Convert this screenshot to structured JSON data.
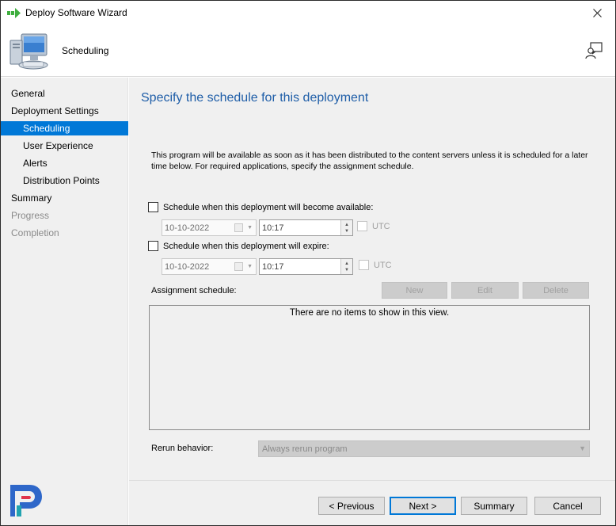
{
  "window": {
    "title": "Deploy Software Wizard"
  },
  "header": {
    "title": "Scheduling"
  },
  "nav": {
    "items": [
      {
        "label": "General",
        "level": 1,
        "state": "normal"
      },
      {
        "label": "Deployment Settings",
        "level": 1,
        "state": "normal"
      },
      {
        "label": "Scheduling",
        "level": 2,
        "state": "selected"
      },
      {
        "label": "User Experience",
        "level": 2,
        "state": "normal"
      },
      {
        "label": "Alerts",
        "level": 2,
        "state": "normal"
      },
      {
        "label": "Distribution Points",
        "level": 2,
        "state": "normal"
      },
      {
        "label": "Summary",
        "level": 1,
        "state": "normal"
      },
      {
        "label": "Progress",
        "level": 1,
        "state": "disabled"
      },
      {
        "label": "Completion",
        "level": 1,
        "state": "disabled"
      }
    ]
  },
  "content": {
    "title": "Specify the schedule for this deployment",
    "description": "This program will be available as soon as it has been distributed to the content servers unless it is scheduled for a later time below. For required applications, specify the assignment schedule.",
    "available": {
      "checkbox_label": "Schedule when this deployment will become available:",
      "checked": false,
      "date": "10-10-2022",
      "time": "10:17",
      "utc_label": "UTC"
    },
    "expire": {
      "checkbox_label": "Schedule when this deployment will expire:",
      "checked": false,
      "date": "10-10-2022",
      "time": "10:17",
      "utc_label": "UTC"
    },
    "assignment": {
      "label": "Assignment schedule:",
      "new_label": "New",
      "edit_label": "Edit",
      "delete_label": "Delete",
      "empty_text": "There are no items to show in this view."
    },
    "rerun": {
      "label": "Rerun behavior:",
      "value": "Always rerun program"
    }
  },
  "footer": {
    "previous_label": "< Previous",
    "next_label": "Next >",
    "summary_label": "Summary",
    "cancel_label": "Cancel"
  },
  "colors": {
    "accent": "#0078d7",
    "title_blue": "#1f5ea8",
    "panel_bg": "#f0f0f0"
  }
}
